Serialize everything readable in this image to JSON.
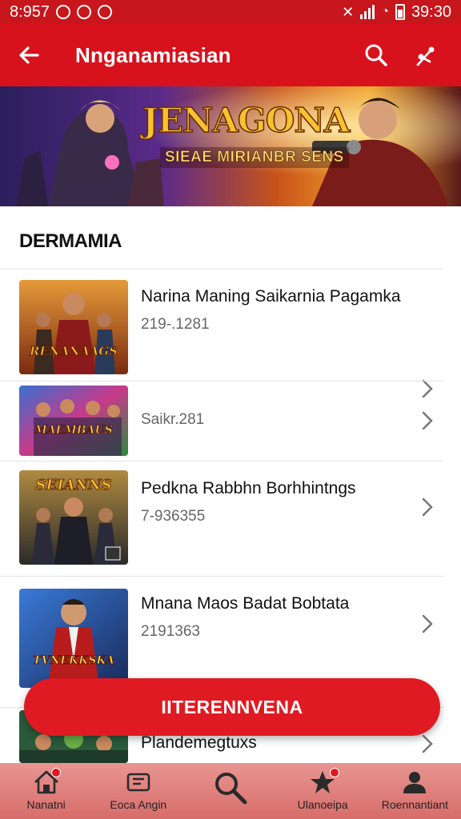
{
  "status_bar": {
    "left_time": "8:957",
    "right_time": "39:30"
  },
  "app_bar": {
    "title": "Nnganamiasian",
    "back_icon": "arrow-left-icon",
    "search_icon": "search-icon",
    "share_icon": "share-icon"
  },
  "banner": {
    "title": "JENAGONA",
    "subtitle": "SIEAE MIRIANBR SENS"
  },
  "section": {
    "title": "DERMAMIA"
  },
  "items": [
    {
      "name": "Narina Maning Saikarnia Pagamka",
      "meta": "219-.1281",
      "thumb_label": "RENANAAGS"
    },
    {
      "name": "",
      "meta": "Saikr.281",
      "thumb_label": "MAEMBAUS"
    },
    {
      "name": "Pedkna Rabbhn Borhhintngs",
      "meta": "7-936355",
      "thumb_label": "SEIANNS"
    },
    {
      "name": "Mnana Maos Badat Bobtata",
      "meta": "2191363",
      "thumb_label": "TVNEKKSKA"
    },
    {
      "name": "Plandemegtuxs",
      "meta": "",
      "thumb_label": ""
    }
  ],
  "fab": {
    "label": "IITERENNVENA"
  },
  "bottom_nav": [
    {
      "label": "Nanatni",
      "icon": "home-icon"
    },
    {
      "label": "Eoca Angin",
      "icon": "library-icon"
    },
    {
      "label": "",
      "icon": "search-icon"
    },
    {
      "label": "Ulanoeipa",
      "icon": "star-icon"
    },
    {
      "label": "Roennantiant",
      "icon": "profile-icon"
    }
  ],
  "colors": {
    "primary_red": "#d7121c",
    "status_bar_red": "#c8161d",
    "fab_red": "#e01a22",
    "bottom_nav_top": "#e89591",
    "bottom_nav_bottom": "#d76d6a"
  }
}
